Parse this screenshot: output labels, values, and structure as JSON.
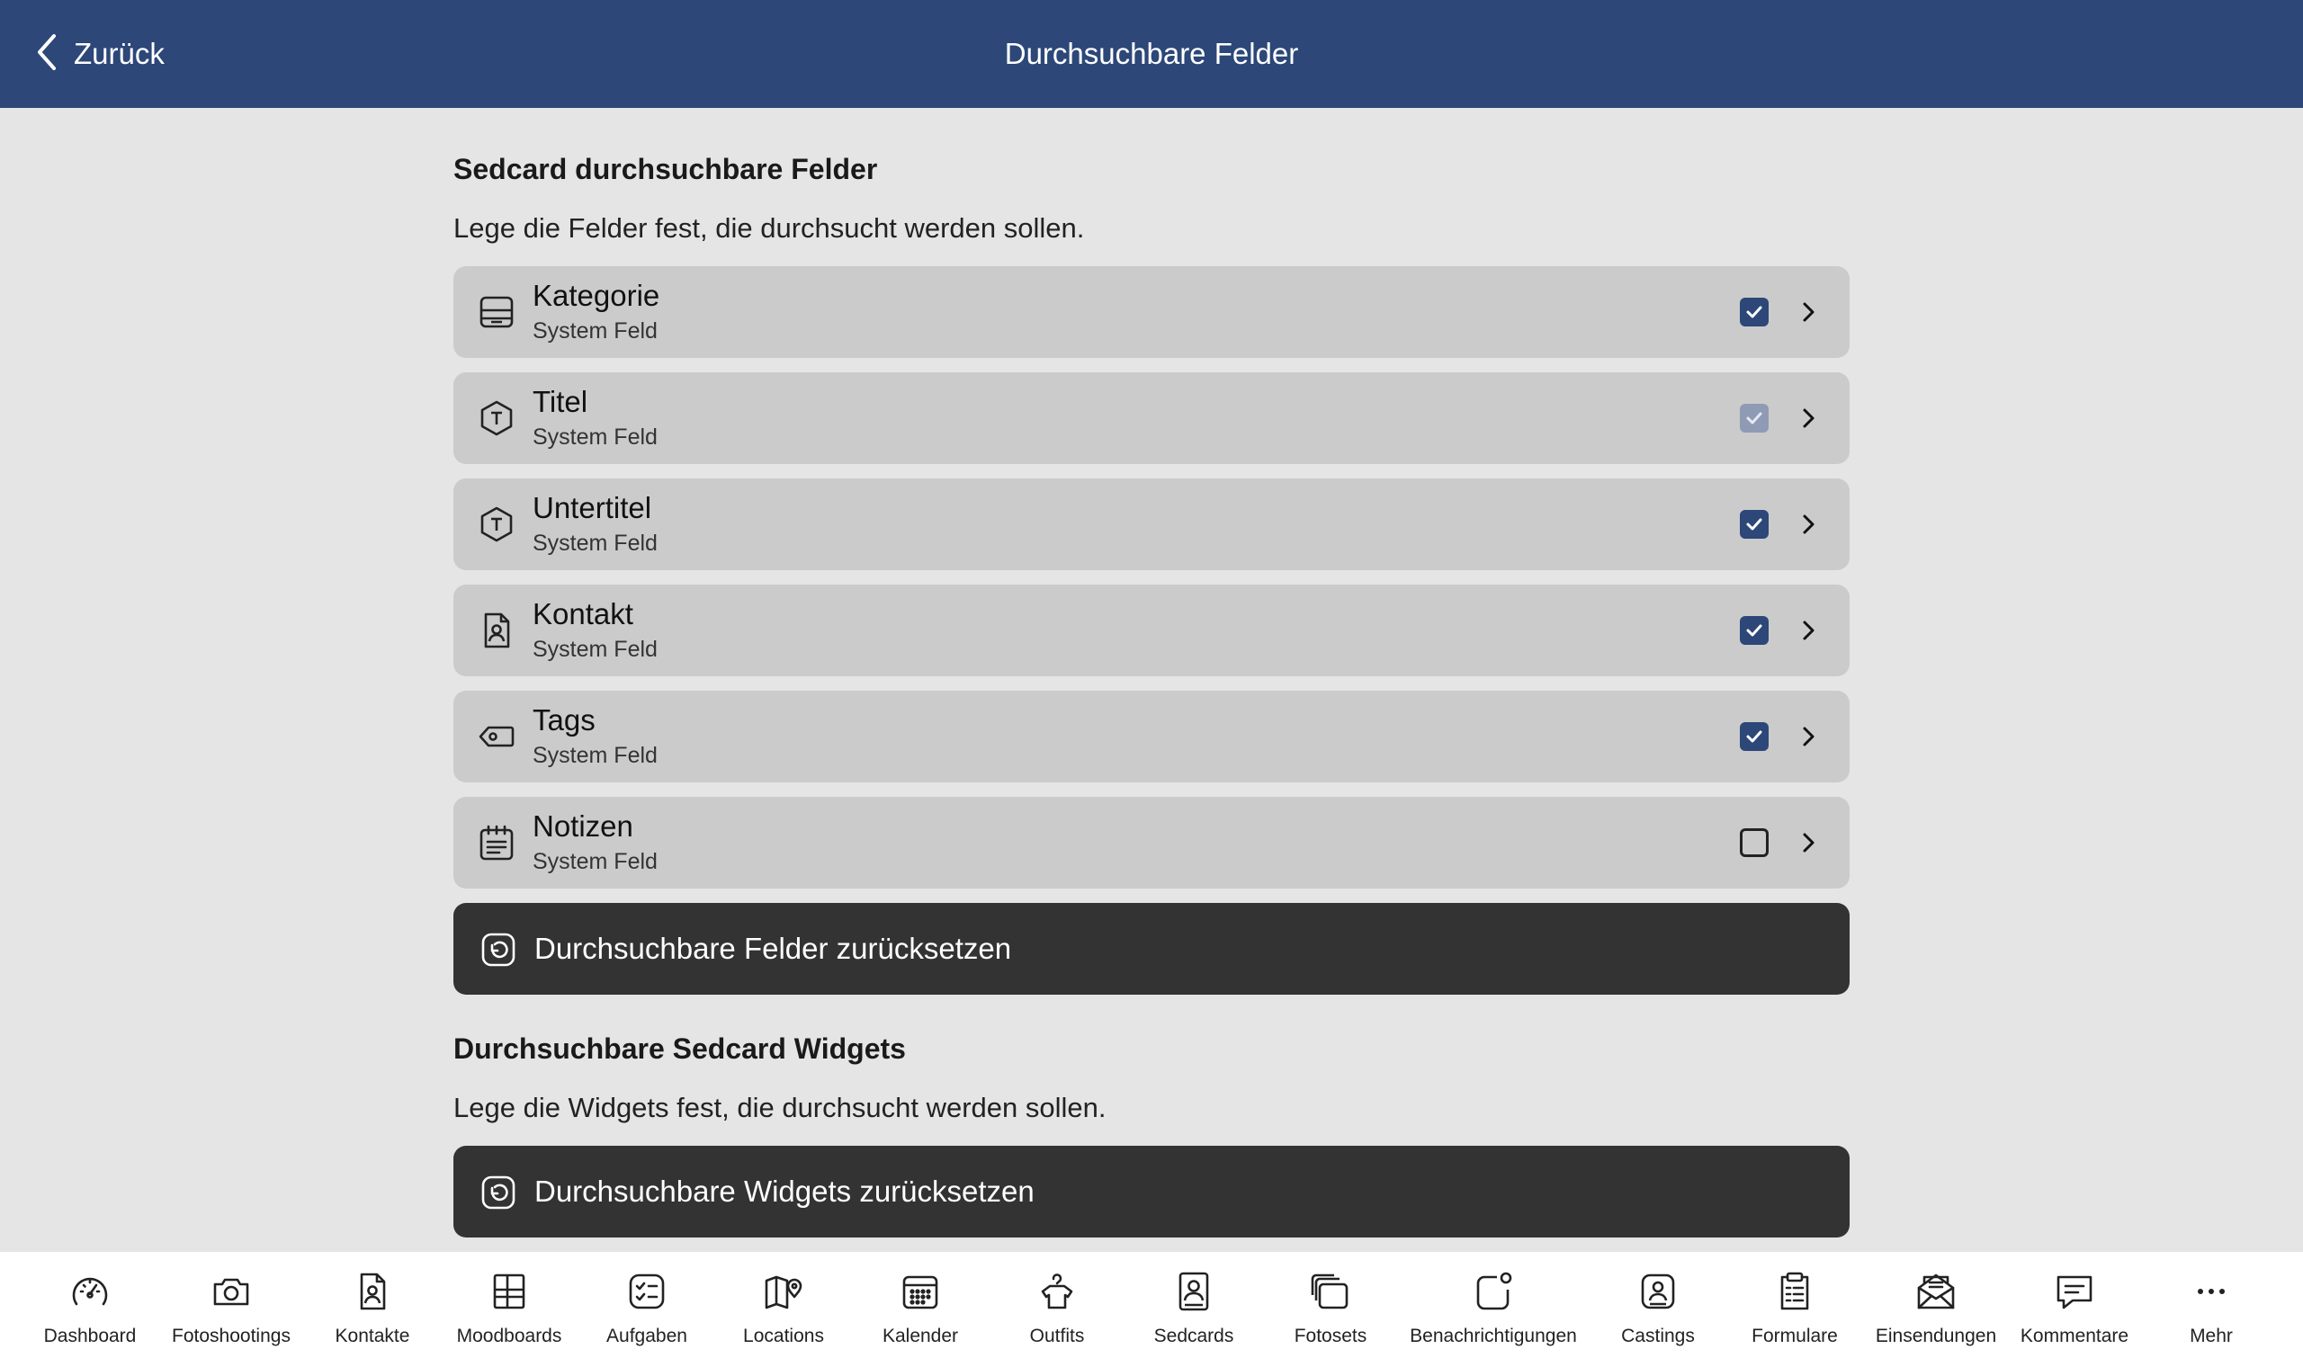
{
  "header": {
    "back_label": "Zurück",
    "title": "Durchsuchbare Felder"
  },
  "fields_section": {
    "title": "Sedcard durchsuchbare Felder",
    "description": "Lege die Felder fest, die durchsucht werden sollen.",
    "items": [
      {
        "name": "Kategorie",
        "sub": "System Feld",
        "icon": "archive-icon",
        "state": "checked"
      },
      {
        "name": "Titel",
        "sub": "System Feld",
        "icon": "text-hexagon-icon",
        "state": "checked-disabled"
      },
      {
        "name": "Untertitel",
        "sub": "System Feld",
        "icon": "text-hexagon-icon",
        "state": "checked"
      },
      {
        "name": "Kontakt",
        "sub": "System Feld",
        "icon": "contact-file-icon",
        "state": "checked"
      },
      {
        "name": "Tags",
        "sub": "System Feld",
        "icon": "tag-icon",
        "state": "checked"
      },
      {
        "name": "Notizen",
        "sub": "System Feld",
        "icon": "notes-calendar-icon",
        "state": "unchecked"
      }
    ],
    "reset_label": "Durchsuchbare Felder zurücksetzen"
  },
  "widgets_section": {
    "title": "Durchsuchbare Sedcard Widgets",
    "description": "Lege die Widgets fest, die durchsucht werden sollen.",
    "reset_label": "Durchsuchbare Widgets zurücksetzen"
  },
  "tabbar": {
    "items": [
      {
        "label": "Dashboard",
        "icon": "speedometer-icon"
      },
      {
        "label": "Fotoshootings",
        "icon": "camera-icon"
      },
      {
        "label": "Kontakte",
        "icon": "contact-file-icon"
      },
      {
        "label": "Moodboards",
        "icon": "moodboard-grid-icon"
      },
      {
        "label": "Aufgaben",
        "icon": "task-list-icon"
      },
      {
        "label": "Locations",
        "icon": "map-pin-icon"
      },
      {
        "label": "Kalender",
        "icon": "calendar-icon"
      },
      {
        "label": "Outfits",
        "icon": "shirt-hanger-icon"
      },
      {
        "label": "Sedcards",
        "icon": "portrait-card-icon"
      },
      {
        "label": "Fotosets",
        "icon": "photo-stack-icon"
      },
      {
        "label": "Benachrichtigungen",
        "icon": "notification-badge-icon"
      },
      {
        "label": "Castings",
        "icon": "casting-card-icon"
      },
      {
        "label": "Formulare",
        "icon": "clipboard-form-icon"
      },
      {
        "label": "Einsendungen",
        "icon": "mail-open-icon"
      },
      {
        "label": "Kommentare",
        "icon": "comment-icon"
      },
      {
        "label": "Mehr",
        "icon": "more-dots-icon"
      }
    ]
  },
  "colors": {
    "header_bg": "#2c4778",
    "accent": "#2c4778",
    "button_dark": "#333333",
    "row_bg": "#cbcbcb",
    "page_bg": "#e5e5e5"
  }
}
